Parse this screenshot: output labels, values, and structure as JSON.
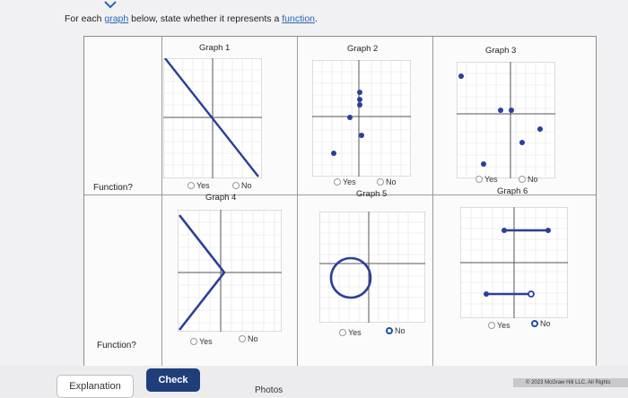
{
  "prompt": {
    "before": "For each ",
    "link1": "graph",
    "middle": " below, state whether it represents a ",
    "link2": "function",
    "after": "."
  },
  "row_labels": [
    "Function?",
    "Function?"
  ],
  "graphs": [
    {
      "title": "Graph 1",
      "yes": "Yes",
      "no": "No",
      "selected": "none"
    },
    {
      "title": "Graph 2",
      "yes": "Yes",
      "no": "No",
      "selected": "none"
    },
    {
      "title": "Graph 3",
      "yes": "Yes",
      "no": "No",
      "selected": "none"
    },
    {
      "title": "Graph 4",
      "yes": "Yes",
      "no": "No",
      "selected": "none"
    },
    {
      "title": "Graph 5",
      "yes": "Yes",
      "no": "No",
      "selected": "no"
    },
    {
      "title": "Graph 6",
      "yes": "Yes",
      "no": "No",
      "selected": "no"
    }
  ],
  "buttons": {
    "explanation": "Explanation",
    "check": "Check"
  },
  "photos": "Photos",
  "copyright": "© 2023 McGraw Hill LLC. All Rights",
  "colors": {
    "accent": "#1f3f7a",
    "graph_line": "#2b3f9a"
  }
}
